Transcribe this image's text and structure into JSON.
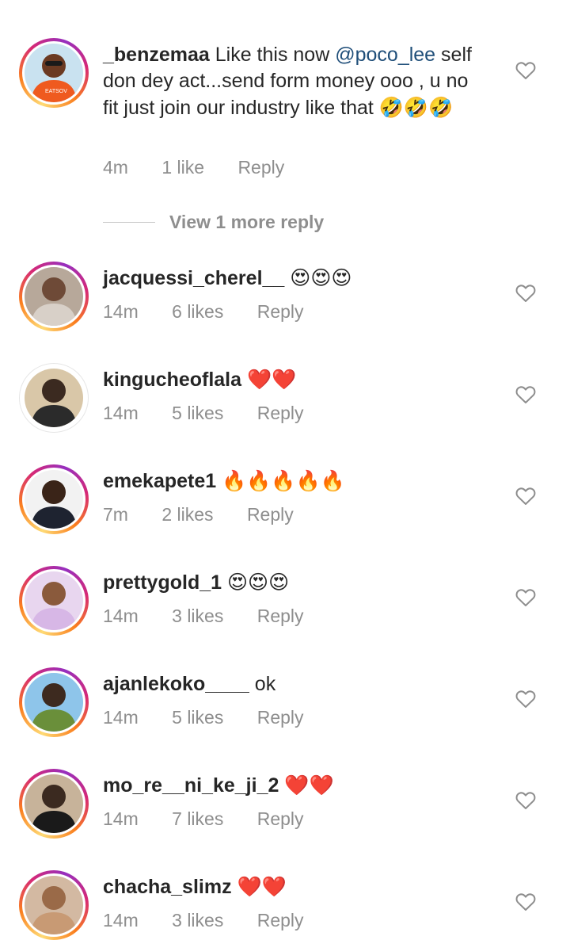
{
  "comments": [
    {
      "username": "_benzemaa",
      "text_before": "Like this now",
      "mention": "@poco_lee",
      "text_after": "self don dey act...send form money ooo , u no fit just join our industry like that",
      "emoji": "🤣🤣🤣",
      "time": "4m",
      "likes": "1 like",
      "reply": "Reply",
      "ring": "story",
      "avatar_icon": "user-photo-orange-shirt",
      "skin": "#6b3a22",
      "cloth": "#ef5a1f",
      "bg": "#c9e2f0"
    },
    {
      "username": "jacquessi_cherel__",
      "text": "",
      "emoji": "😍😍😍",
      "time": "14m",
      "likes": "6 likes",
      "reply": "Reply",
      "ring": "story",
      "avatar_icon": "user-photo-young-man",
      "skin": "#6e4a37",
      "cloth": "#d8d0c8",
      "bg": "#b7a89a"
    },
    {
      "username": "kingucheoflala",
      "text": "",
      "emoji": "❤️❤️",
      "time": "14m",
      "likes": "5 likes",
      "reply": "Reply",
      "ring": "plain",
      "avatar_icon": "user-photo-standing-man",
      "skin": "#3b2a20",
      "cloth": "#2b2b2b",
      "bg": "#d9c7a8"
    },
    {
      "username": "emekapete1",
      "text": "",
      "emoji": "🔥🔥🔥🔥🔥",
      "time": "7m",
      "likes": "2 likes",
      "reply": "Reply",
      "ring": "story",
      "avatar_icon": "user-photo-suit",
      "skin": "#3a2418",
      "cloth": "#1e2330",
      "bg": "#f2f2f2"
    },
    {
      "username": "prettygold_1",
      "text": "",
      "emoji": "😍😍😍",
      "time": "14m",
      "likes": "3 likes",
      "reply": "Reply",
      "ring": "story",
      "avatar_icon": "user-photo-woman",
      "skin": "#8a5a3c",
      "cloth": "#d7b7e6",
      "bg": "#e8d6ef"
    },
    {
      "username": "ajanlekoko____",
      "text": "ok",
      "emoji": "",
      "time": "14m",
      "likes": "5 likes",
      "reply": "Reply",
      "ring": "story",
      "avatar_icon": "user-photo-group",
      "skin": "#3d2a1f",
      "cloth": "#6a8f3a",
      "bg": "#8ec5ea"
    },
    {
      "username": "mo_re__ni_ke_ji_2",
      "text": "",
      "emoji": "❤️❤️",
      "time": "14m",
      "likes": "7 likes",
      "reply": "Reply",
      "ring": "story",
      "avatar_icon": "user-photo-walking",
      "skin": "#3b2a20",
      "cloth": "#1a1a1a",
      "bg": "#c7b39a"
    },
    {
      "username": "chacha_slimz",
      "text": "",
      "emoji": "❤️❤️",
      "time": "14m",
      "likes": "3 likes",
      "reply": "Reply",
      "ring": "story",
      "avatar_icon": "user-photo-partial",
      "skin": "#9a6a48",
      "cloth": "#c89a74",
      "bg": "#d3b9a2"
    }
  ],
  "view_more_replies": "View 1 more reply",
  "heart_icon": "heart-outline-icon",
  "colors": {
    "text": "#262626",
    "meta": "#8e8e8e",
    "mention": "#1f4e79"
  }
}
